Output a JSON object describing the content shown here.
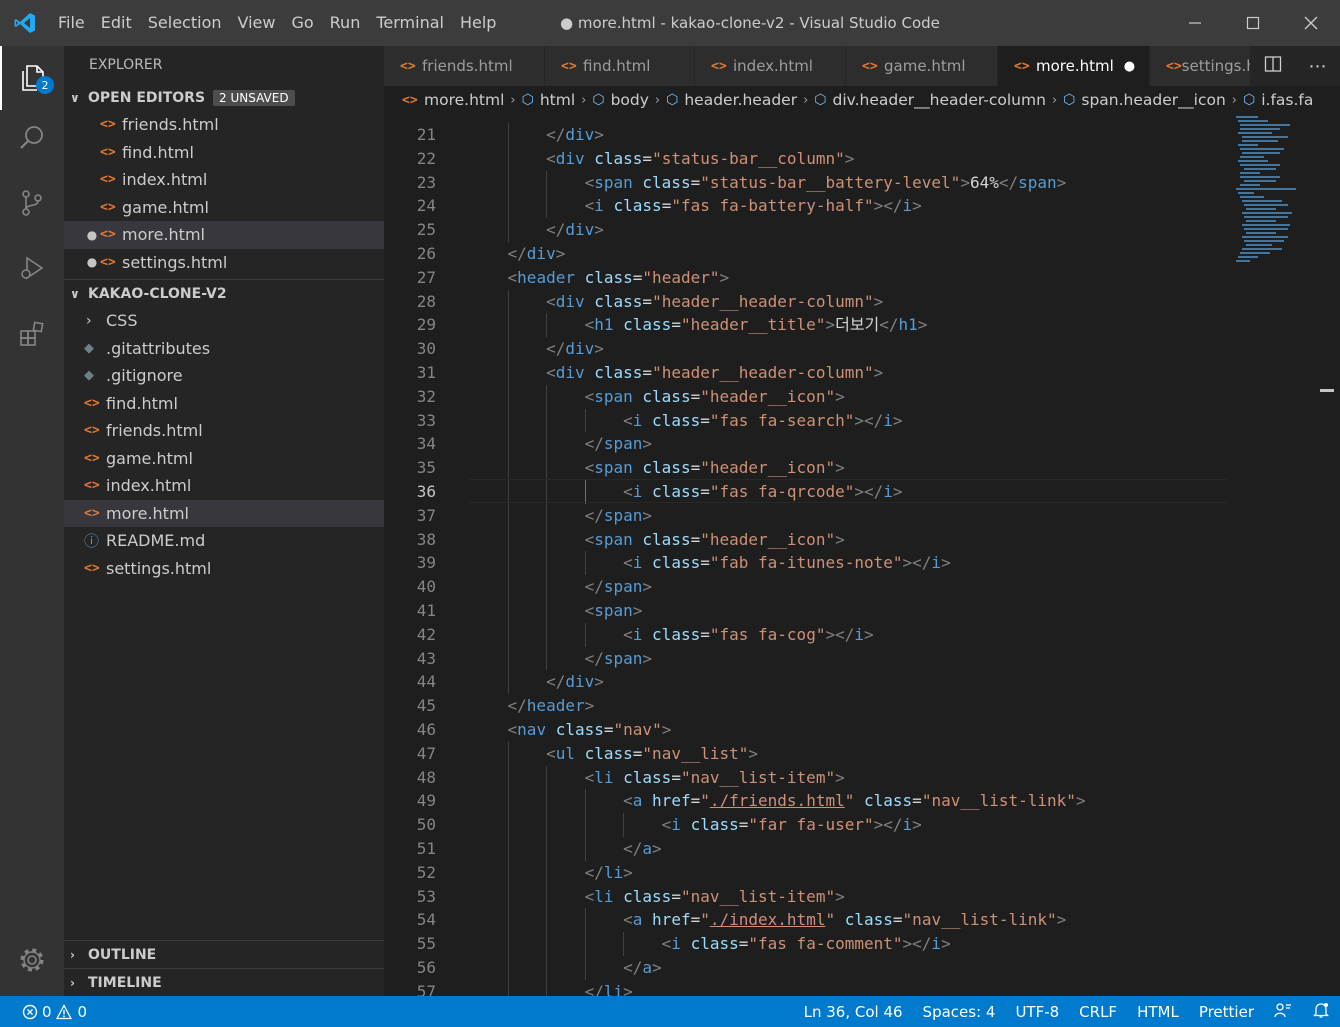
{
  "titlebar": {
    "menu": [
      "File",
      "Edit",
      "Selection",
      "View",
      "Go",
      "Run",
      "Terminal",
      "Help"
    ],
    "title": "● more.html - kakao-clone-v2 - Visual Studio Code"
  },
  "activity": {
    "explorer_badge": "2"
  },
  "sidebar": {
    "title": "EXPLORER",
    "open_editors": {
      "label": "OPEN EDITORS",
      "badge": "2 UNSAVED",
      "items": [
        {
          "name": "friends.html",
          "modified": false
        },
        {
          "name": "find.html",
          "modified": false
        },
        {
          "name": "index.html",
          "modified": false
        },
        {
          "name": "game.html",
          "modified": false
        },
        {
          "name": "more.html",
          "modified": true
        },
        {
          "name": "settings.html",
          "modified": true
        }
      ]
    },
    "project": {
      "label": "KAKAO-CLONE-V2",
      "items": [
        "CSS",
        ".gitattributes",
        ".gitignore",
        "find.html",
        "friends.html",
        "game.html",
        "index.html",
        "more.html",
        "README.md",
        "settings.html"
      ]
    },
    "outline_label": "OUTLINE",
    "timeline_label": "TIMELINE"
  },
  "tabs": [
    "friends.html",
    "find.html",
    "index.html",
    "game.html",
    "more.html",
    "settings.html"
  ],
  "breadcrumbs": [
    "more.html",
    "html",
    "body",
    "header.header",
    "div.header__header-column",
    "span.header__icon",
    "i.fas.fa"
  ],
  "editor": {
    "line_numbers": [
      "21",
      "22",
      "23",
      "24",
      "25",
      "26",
      "27",
      "28",
      "29",
      "30",
      "31",
      "32",
      "33",
      "34",
      "35",
      "36",
      "37",
      "38",
      "39",
      "40",
      "41",
      "42",
      "43",
      "44",
      "45",
      "46",
      "47",
      "48",
      "49",
      "50",
      "51",
      "52",
      "53",
      "54",
      "55",
      "56",
      "57"
    ],
    "lines": [
      "        </div>",
      "        <div class=\"status-bar__column\">",
      "            <span class=\"status-bar__battery-level\">64%</span>",
      "            <i class=\"fas fa-battery-half\"></i>",
      "        </div>",
      "    </div>",
      "    <header class=\"header\">",
      "        <div class=\"header__header-column\">",
      "            <h1 class=\"header__title\">더보기</h1>",
      "        </div>",
      "        <div class=\"header__header-column\">",
      "            <span class=\"header__icon\">",
      "                <i class=\"fas fa-search\"></i>",
      "            </span>",
      "            <span class=\"header__icon\">",
      "                <i class=\"fas fa-qrcode\"></i>",
      "            </span>",
      "            <span class=\"header__icon\">",
      "                <i class=\"fab fa-itunes-note\"></i>",
      "            </span>",
      "            <span>",
      "                <i class=\"fas fa-cog\"></i>",
      "            </span>",
      "        </div>",
      "    </header>",
      "    <nav class=\"nav\">",
      "        <ul class=\"nav__list\">",
      "            <li class=\"nav__list-item\">",
      "                <a href=\"./friends.html\" class=\"nav__list-link\">",
      "                    <i class=\"far fa-user\"></i>",
      "                </a>",
      "            </li>",
      "            <li class=\"nav__list-item\">",
      "                <a href=\"./index.html\" class=\"nav__list-link\">",
      "                    <i class=\"fas fa-comment\"></i>",
      "                </a>",
      "            </li>"
    ]
  },
  "statusbar": {
    "errors": "0",
    "warnings": "0",
    "position": "Ln 36, Col 46",
    "spaces": "Spaces: 4",
    "encoding": "UTF-8",
    "eol": "CRLF",
    "language": "HTML",
    "formatter": "Prettier"
  },
  "colors": {
    "accent": "#007acc",
    "tag": "#569cd6",
    "attribute": "#9cdcfe",
    "string": "#ce9178",
    "html_icon": "#e37933"
  }
}
